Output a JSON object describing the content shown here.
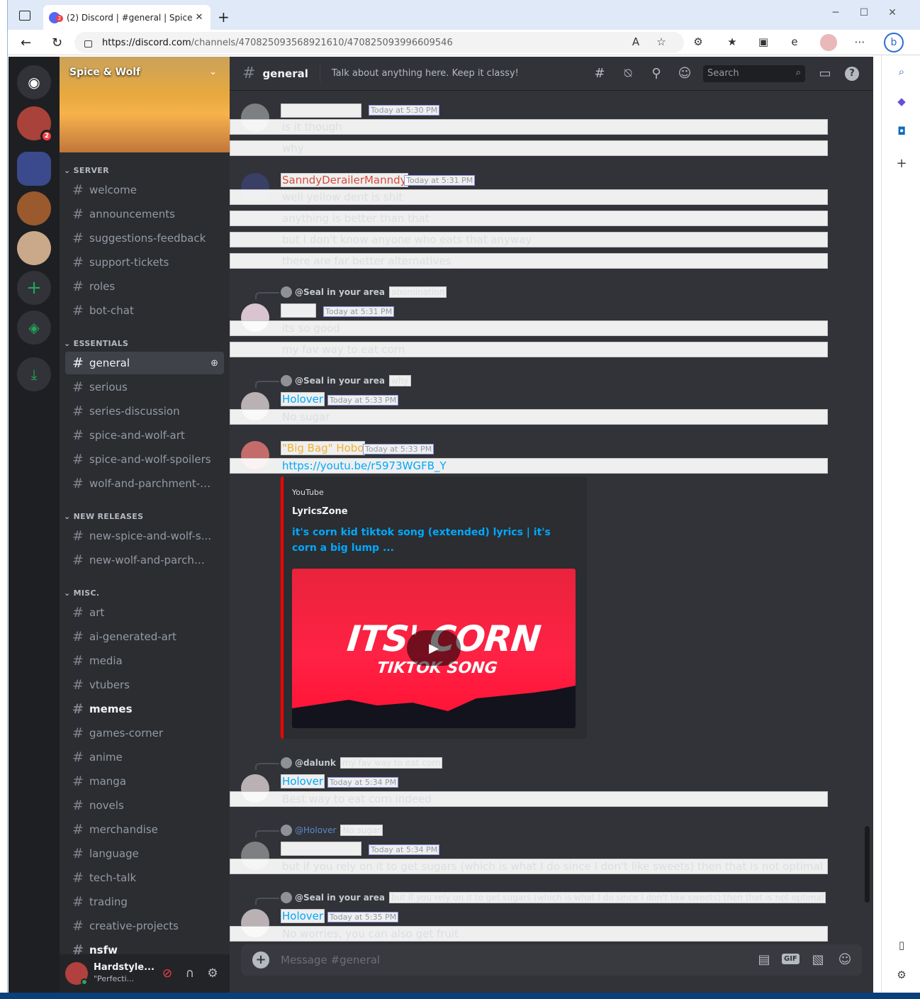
{
  "browser": {
    "tab_title": "(2) Discord | #general | Spice & W",
    "tab_close": "✕",
    "new_tab": "+",
    "url_domain": "https://discord.com",
    "url_path": "/channels/470825093568921610/470825093996609546",
    "min": "─",
    "max": "☐",
    "close": "✕"
  },
  "server": {
    "name": "Spice & Wolf",
    "guild_badge": "2"
  },
  "categories": {
    "server": "SERVER",
    "essentials": "ESSENTIALS",
    "new_releases": "NEW RELEASES",
    "misc": "MISC."
  },
  "channels": {
    "server": [
      "welcome",
      "announcements",
      "suggestions-feedback",
      "support-tickets",
      "roles",
      "bot-chat"
    ],
    "essentials": [
      "general",
      "serious",
      "series-discussion",
      "spice-and-wolf-art",
      "spice-and-wolf-spoilers",
      "wolf-and-parchment-s..."
    ],
    "new_releases": [
      "new-spice-and-wolf-s...",
      "new-wolf-and-parchm..."
    ],
    "misc": [
      "art",
      "ai-generated-art",
      "media",
      "vtubers",
      "memes",
      "games-corner",
      "anime",
      "manga",
      "novels",
      "merchandise",
      "language",
      "tech-talk",
      "trading",
      "creative-projects",
      "nsfw"
    ]
  },
  "user": {
    "name": "Hardstyle...",
    "status": "\"Perfecti..."
  },
  "header": {
    "channel": "general",
    "topic": "Talk about anything here. Keep it classy!",
    "search": "Search"
  },
  "messages": {
    "m1": {
      "time": "Today at 5:30 PM",
      "lines": [
        "is it though",
        "why"
      ]
    },
    "m2": {
      "author": "SanndyDerailerManndy",
      "time": "Today at 5:31 PM",
      "lines": [
        "well yellow dent is shit",
        "anything is better than that",
        "but I don't know anyone who eats that anyway",
        "there are far better alternatives"
      ]
    },
    "m3": {
      "reply_to": "@Seal in your area",
      "reply_text": "abomination",
      "time": "Today at 5:31 PM",
      "lines": [
        "its so good",
        "my fav way to eat corn"
      ]
    },
    "m4": {
      "reply_to": "@Seal in your area",
      "reply_text": "why",
      "author": "Holover",
      "time": "Today at 5:33 PM",
      "lines": [
        "No sugar"
      ]
    },
    "m5": {
      "author": "\"Big Bag\" Hobo",
      "time": "Today at 5:33 PM",
      "link": "https://youtu.be/r5973WGFB_Y"
    },
    "embed": {
      "provider": "YouTube",
      "author": "LyricsZone",
      "title": "it's corn kid tiktok song (extended) lyrics | it's corn a big lump ...",
      "thumb_line1": "ITS' CORN",
      "thumb_line2": "TIKTOK SONG"
    },
    "m6": {
      "reply_to": "@dalunk",
      "reply_text": "my fav way to eat corn",
      "author": "Holover",
      "time": "Today at 5:34 PM",
      "lines": [
        "Best way to eat corn indeed"
      ]
    },
    "m7": {
      "reply_to": "@Holover",
      "reply_text": "No sugar",
      "time": "Today at 5:34 PM",
      "lines": [
        "but if you rely on it to get sugars (which is what I do since I don't like sweets) then that is not optimal"
      ]
    },
    "m8": {
      "reply_to": "@Seal in your area",
      "reply_text": "but if you rely on it to get sugars (which is what I do since I don't like sweets) then that is not optimal",
      "author": "Holover",
      "time": "Today at 5:35 PM",
      "lines": [
        "No worries, you can also get fruit"
      ]
    }
  },
  "composer": {
    "placeholder": "Message #general",
    "gif": "GIF"
  },
  "colors": {
    "red_name": "#f23f43",
    "blue_name": "#00a8fc",
    "orange_name": "#f0b232",
    "reply_mention": "#5d87c7"
  }
}
